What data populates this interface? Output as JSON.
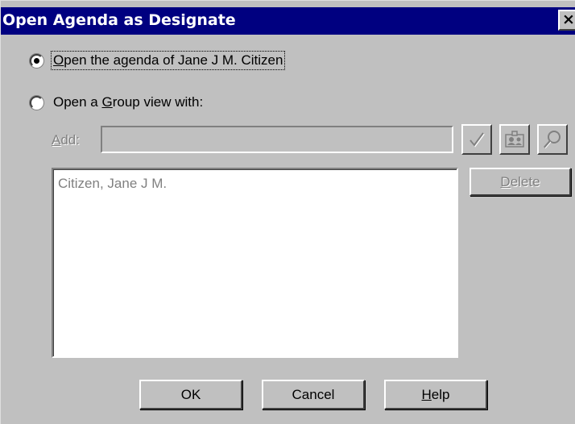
{
  "window": {
    "title": "Open Agenda as Designate",
    "close_glyph": "✕"
  },
  "options": {
    "own_agenda": {
      "prefix": "",
      "mnemonic": "O",
      "suffix": "pen the agenda of Jane J M. Citizen",
      "checked": true
    },
    "group_view": {
      "prefix": "Open a ",
      "mnemonic": "G",
      "suffix": "roup view with:",
      "checked": false
    }
  },
  "add": {
    "label_mnemonic": "A",
    "label_rest": "dd:",
    "value": ""
  },
  "toolbar": {
    "check_icon": "check-icon",
    "address_book_icon": "address-book-icon",
    "search_icon": "magnifier-icon"
  },
  "list": {
    "items": [
      "Citizen, Jane J M."
    ]
  },
  "buttons": {
    "delete_mnemonic": "D",
    "delete_rest": "elete",
    "ok": "OK",
    "cancel": "Cancel",
    "help_mnemonic": "H",
    "help_rest": "elp"
  },
  "colors": {
    "titlebar": "#000080",
    "face": "#c0c0c0",
    "disabled_text": "#808080"
  }
}
